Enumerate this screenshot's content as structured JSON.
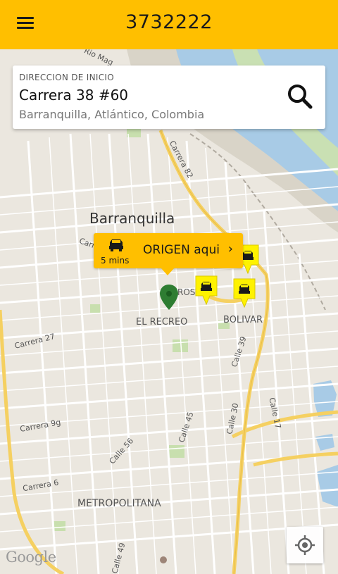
{
  "app": {
    "title": "3732222"
  },
  "search": {
    "label": "DIRECCION DE INICIO",
    "address": "Carrera 38 #60",
    "city": "Barranquilla, Atlántico, Colombia"
  },
  "origin": {
    "eta": "5 mins",
    "label": "ORIGEN aqui"
  },
  "map": {
    "places": {
      "city": "Barranquilla",
      "el_recreo": "EL RECREO",
      "bolivar": "BOLIVAR",
      "metropolitana": "METROPOLITANA",
      "rio": "Rio Mag",
      "rosto": "ROSTO",
      "carre_partial": "Carre"
    },
    "streets": {
      "carrera82": "Carrera 82",
      "carrera27": "Carrera 27",
      "carrera9g": "Carrera 9g",
      "carrera6": "Carrera 6",
      "calle56": "Calle 56",
      "calle45": "Calle 45",
      "calle39": "Calle 39",
      "calle30": "Calle 30",
      "calle17": "Calle 17",
      "calle49": "Calle 49"
    },
    "google": "Google"
  },
  "colors": {
    "accent": "#ffbf00",
    "pin": "#2e7d32",
    "water": "#a8cbe6",
    "park": "#c8dfae"
  }
}
